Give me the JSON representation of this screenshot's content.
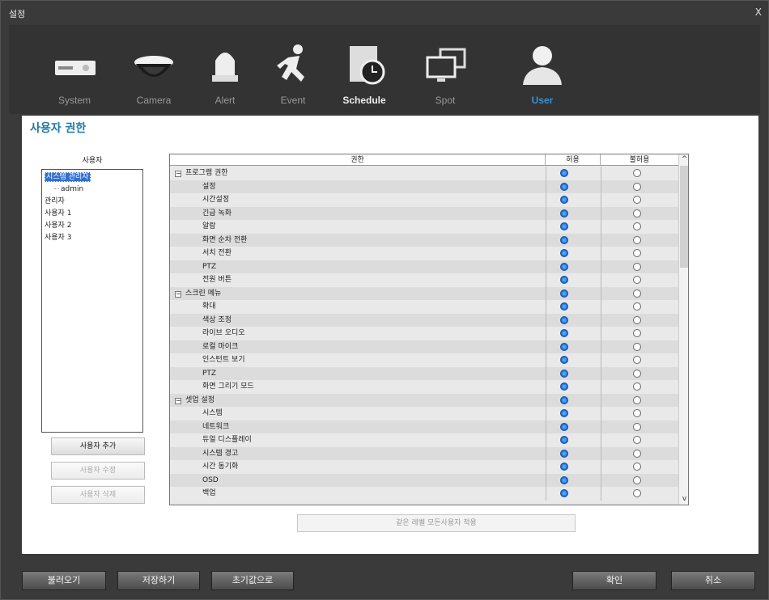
{
  "window": {
    "title": "설정",
    "close": "X"
  },
  "nav": [
    {
      "label": "System",
      "icon": "dvr-icon",
      "state": "normal"
    },
    {
      "label": "Camera",
      "icon": "dome-camera-icon",
      "state": "normal"
    },
    {
      "label": "Alert",
      "icon": "alarm-light-icon",
      "state": "normal"
    },
    {
      "label": "Event",
      "icon": "running-man-icon",
      "state": "normal"
    },
    {
      "label": "Schedule",
      "icon": "clock-icon",
      "state": "selected"
    },
    {
      "label": "Spot",
      "icon": "monitors-icon",
      "state": "normal"
    },
    {
      "label": "User",
      "icon": "user-icon",
      "state": "current"
    }
  ],
  "page_title": "사용자 권한",
  "users": {
    "label": "사용자",
    "items": [
      {
        "text": "시스템 관리자",
        "level": 0,
        "selected": true
      },
      {
        "text": "admin",
        "level": 1
      },
      {
        "text": "관리자",
        "level": 0
      },
      {
        "text": "사용자 1",
        "level": 0
      },
      {
        "text": "사용자 2",
        "level": 0
      },
      {
        "text": "사용자 3",
        "level": 0
      }
    ]
  },
  "buttons": {
    "add": "사용자 추가",
    "edit": "사용자 수정",
    "delete": "사용자 삭제",
    "apply_all": "같은 레벨 모든사용자 적용"
  },
  "grid": {
    "headers": {
      "perm": "권한",
      "allow": "허용",
      "deny": "불허용"
    },
    "rows": [
      {
        "label": "프로그램 권한",
        "group": true,
        "allow": true
      },
      {
        "label": "설정",
        "allow": true
      },
      {
        "label": "시간설정",
        "allow": true
      },
      {
        "label": "긴급 녹화",
        "allow": true
      },
      {
        "label": "알람",
        "allow": true
      },
      {
        "label": "화면 순차 전환",
        "allow": true
      },
      {
        "label": "서치 전환",
        "allow": true
      },
      {
        "label": "PTZ",
        "allow": true
      },
      {
        "label": "전원 버튼",
        "allow": true
      },
      {
        "label": "스크린 메뉴",
        "group": true,
        "allow": true
      },
      {
        "label": "확대",
        "allow": true
      },
      {
        "label": "색상 조정",
        "allow": true
      },
      {
        "label": "라이브 오디오",
        "allow": true
      },
      {
        "label": "로컬 마이크",
        "allow": true
      },
      {
        "label": "인스턴트 보기",
        "allow": true
      },
      {
        "label": "PTZ",
        "allow": true
      },
      {
        "label": "화면 그리기 모드",
        "allow": true
      },
      {
        "label": "셋업 설정",
        "group": true,
        "allow": true
      },
      {
        "label": "시스템",
        "allow": true
      },
      {
        "label": "네트워크",
        "allow": true
      },
      {
        "label": "듀얼 디스플레이",
        "allow": true
      },
      {
        "label": "시스템 경고",
        "allow": true
      },
      {
        "label": "시간 동기화",
        "allow": true
      },
      {
        "label": "OSD",
        "allow": true
      },
      {
        "label": "백업",
        "allow": true
      }
    ]
  },
  "footer": {
    "load": "불러오기",
    "save": "저장하기",
    "default": "초기값으로",
    "ok": "확인",
    "cancel": "취소"
  },
  "scrollbar": {
    "up": "^",
    "down": "v"
  }
}
